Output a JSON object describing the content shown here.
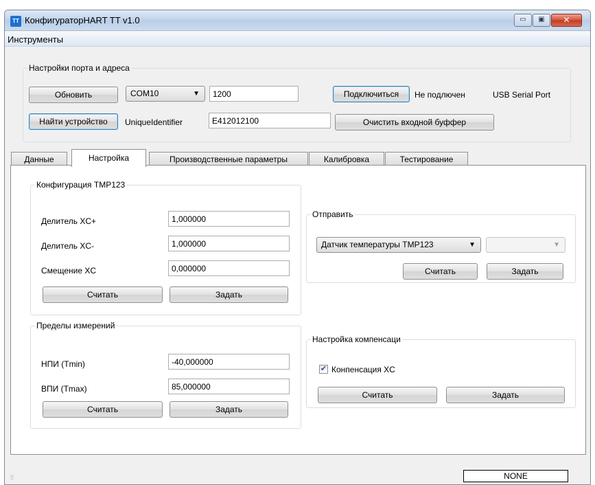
{
  "window": {
    "icon_text": "TT",
    "title": "КонфигураторHART TT v1.0",
    "min_glyph": "▭",
    "max_glyph": "▣",
    "close_glyph": "✕"
  },
  "menu": {
    "tools": "Инструменты"
  },
  "port": {
    "legend": "Настройки порта и адреса",
    "refresh": "Обновить",
    "port_value": "COM10",
    "baud_value": "1200",
    "connect": "Подключиться",
    "connection_status": "Не подлючен",
    "port_description": "USB Serial Port",
    "find_device": "Найти устройство",
    "uid_label": "UniqueIdentifier",
    "uid_value": "E412012100",
    "clear_buffer": "Очистить входной буффер"
  },
  "tabs": [
    {
      "label": "Данные"
    },
    {
      "label": "Настройка"
    },
    {
      "label": "Производственные параметры"
    },
    {
      "label": "Калибровка"
    },
    {
      "label": "Тестирование"
    }
  ],
  "tmp_config": {
    "legend": "Конфигурация TMP123",
    "divider_plus_label": "Делитель XC+",
    "divider_plus_value": "1,000000",
    "divider_minus_label": "Делитель XC-",
    "divider_minus_value": "1,000000",
    "offset_label": "Смещение XC",
    "offset_value": "0,000000",
    "read": "Считать",
    "set": "Задать"
  },
  "limits": {
    "legend": "Пределы измерений",
    "lower_label": "НПИ (Tmin)",
    "lower_value": "-40,000000",
    "upper_label": "ВПИ (Tmax)",
    "upper_value": "85,000000",
    "read": "Считать",
    "set": "Задать"
  },
  "send": {
    "legend": "Отправить",
    "sensor_value": "Датчик температуры TMP123",
    "read": "Считать",
    "set": "Задать"
  },
  "compensation": {
    "legend": "Настройка компенсаци",
    "checkbox_label": "Конпенсация XC",
    "checked_glyph": "✔",
    "read": "Считать",
    "set": "Задать"
  },
  "status": {
    "grip_glyph": "⁞⁞",
    "panel_text": "NONE"
  },
  "dropdown_glyph": "▼"
}
